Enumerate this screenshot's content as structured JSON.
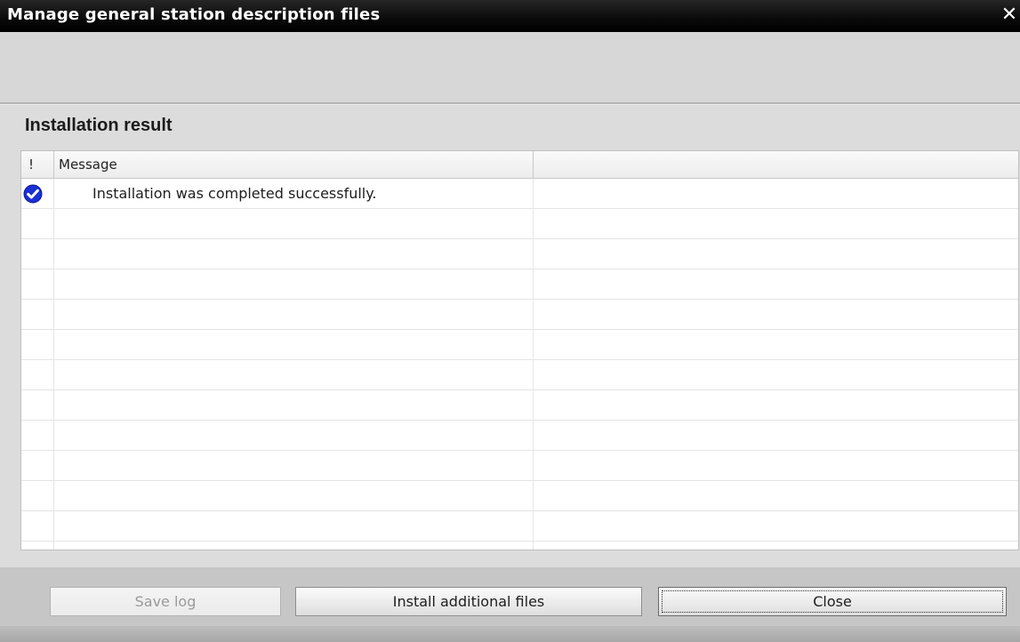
{
  "window": {
    "title": "Manage general station description files",
    "close_glyph": "✕"
  },
  "section": {
    "title": "Installation result"
  },
  "grid": {
    "columns": [
      "!",
      "Message",
      ""
    ],
    "rows": [
      {
        "icon": "check-circle-icon",
        "message": "Installation was completed successfully."
      }
    ]
  },
  "buttons": {
    "save_log": "Save log",
    "install_additional": "Install additional files",
    "close": "Close"
  },
  "colors": {
    "titlebar": "#000000",
    "success_icon": "#1a2fd6"
  }
}
